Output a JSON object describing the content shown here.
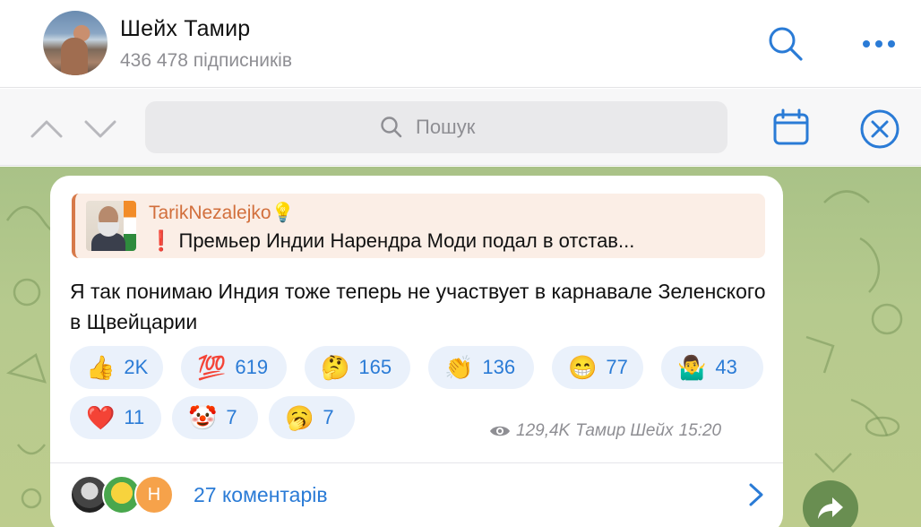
{
  "header": {
    "title": "Шейх Тамир",
    "subtitle": "436 478 підписників"
  },
  "search": {
    "placeholder": "Пошук"
  },
  "message": {
    "reply": {
      "author": "TarikNezalejko💡",
      "text": "❗️ Премьер Индии Нарендра Моди подал в отстав..."
    },
    "text": "Я так понимаю Индия тоже теперь не участвует в карнавале Зеленского в Щвейцарии",
    "reactions": [
      {
        "emoji": "👍",
        "count": "2K"
      },
      {
        "emoji": "💯",
        "count": "619"
      },
      {
        "emoji": "🤔",
        "count": "165"
      },
      {
        "emoji": "👏",
        "count": "136"
      },
      {
        "emoji": "😁",
        "count": "77"
      },
      {
        "emoji": "🤷‍♂️",
        "count": "43"
      },
      {
        "emoji": "❤️",
        "count": "11"
      },
      {
        "emoji": "🤡",
        "count": "7"
      },
      {
        "emoji": "🥱",
        "count": "7"
      }
    ],
    "views": "129,4K",
    "author_sign": "Тамир Шейх",
    "time": "15:20",
    "comments": {
      "label": "27 коментарів",
      "avatar_letter": "Н"
    }
  },
  "colors": {
    "accent": "#2a7bd6",
    "reply_accent": "#d26f3c",
    "chat_bg": "#b3c88c"
  },
  "icons": [
    "search-icon",
    "more-icon",
    "chevron-up-icon",
    "chevron-down-icon",
    "magnifier-icon",
    "calendar-icon",
    "close-icon",
    "eye-icon",
    "chevron-right-icon",
    "share-icon"
  ]
}
